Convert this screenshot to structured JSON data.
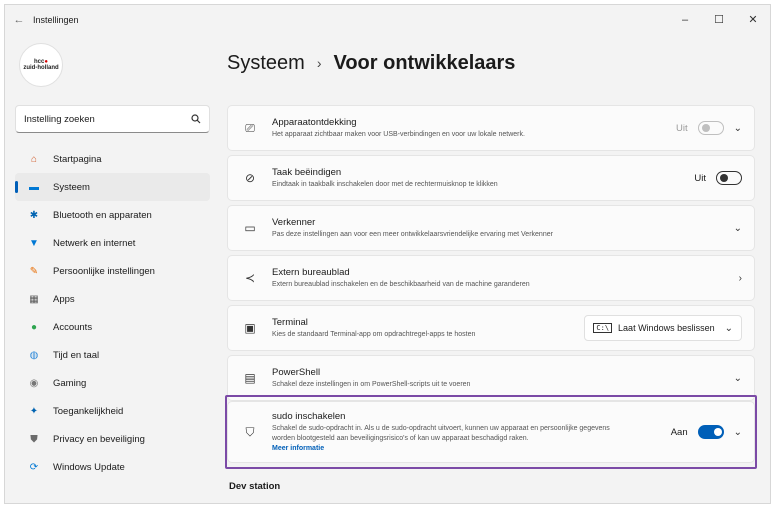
{
  "window": {
    "title": "Instellingen",
    "back": "←",
    "min": "–",
    "max": "☐",
    "close": "✕"
  },
  "profile": {
    "line1": "hcc",
    "dot": "●",
    "line2": "zuid-holland"
  },
  "search": {
    "label": "Instelling zoeken",
    "icon": "search-icon"
  },
  "nav": [
    {
      "label": "Startpagina",
      "icon": "home-icon",
      "glyph": "⌂",
      "color": "#d15b2a"
    },
    {
      "label": "Systeem",
      "icon": "system-icon",
      "glyph": "▬",
      "color": "#0078d4"
    },
    {
      "label": "Bluetooth en apparaten",
      "icon": "bluetooth-icon",
      "glyph": "✱",
      "color": "#0063b1"
    },
    {
      "label": "Netwerk en internet",
      "icon": "network-icon",
      "glyph": "▼",
      "color": "#0078d4"
    },
    {
      "label": "Persoonlijke instellingen",
      "icon": "brush-icon",
      "glyph": "✎",
      "color": "#e86c00"
    },
    {
      "label": "Apps",
      "icon": "apps-icon",
      "glyph": "▦",
      "color": "#555555"
    },
    {
      "label": "Accounts",
      "icon": "accounts-icon",
      "glyph": "●",
      "color": "#2ea44f"
    },
    {
      "label": "Tijd en taal",
      "icon": "globe-icon",
      "glyph": "◍",
      "color": "#2b88d8"
    },
    {
      "label": "Gaming",
      "icon": "gaming-icon",
      "glyph": "◉",
      "color": "#777777"
    },
    {
      "label": "Toegankelijkheid",
      "icon": "accessibility-icon",
      "glyph": "✦",
      "color": "#0063b1"
    },
    {
      "label": "Privacy en beveiliging",
      "icon": "shield-icon",
      "glyph": "⛊",
      "color": "#6b6b6b"
    },
    {
      "label": "Windows Update",
      "icon": "update-icon",
      "glyph": "⟳",
      "color": "#0078d4"
    }
  ],
  "breadcrumb": {
    "parent": "Systeem",
    "sep": "›",
    "current": "Voor ontwikkelaars"
  },
  "cards": {
    "device": {
      "title": "Apparaatontdekking",
      "desc": "Het apparaat zichtbaar maken voor USB-verbindingen en voor uw lokale netwerk.",
      "state": "Uit"
    },
    "endtask": {
      "title": "Taak beëindigen",
      "desc": "Eindtaak in taakbalk inschakelen door met de rechtermuisknop te klikken",
      "state": "Uit"
    },
    "explorer": {
      "title": "Verkenner",
      "desc": "Pas deze instellingen aan voor een meer ontwikkelaarsvriendelijke ervaring met Verkenner"
    },
    "remote": {
      "title": "Extern bureaublad",
      "desc": "Extern bureaublad inschakelen en de beschikbaarheid van de machine garanderen"
    },
    "terminal": {
      "title": "Terminal",
      "desc": "Kies de standaard Terminal-app om opdrachtregel-apps te hosten",
      "dropdown": "Laat Windows beslissen"
    },
    "powershell": {
      "title": "PowerShell",
      "desc": "Schakel deze instellingen in om PowerShell-scripts uit te voeren"
    },
    "sudo": {
      "title": "sudo inschakelen",
      "desc1": "Schakel de sudo-opdracht in. Als u de sudo-opdracht uitvoert, kunnen uw apparaat en persoonlijke gegevens",
      "desc2": "worden blootgesteld aan beveiligingsrisico's of kan uw apparaat beschadigd raken.",
      "link": "Meer informatie",
      "state": "Aan"
    }
  },
  "section": {
    "dev_station": "Dev station"
  }
}
